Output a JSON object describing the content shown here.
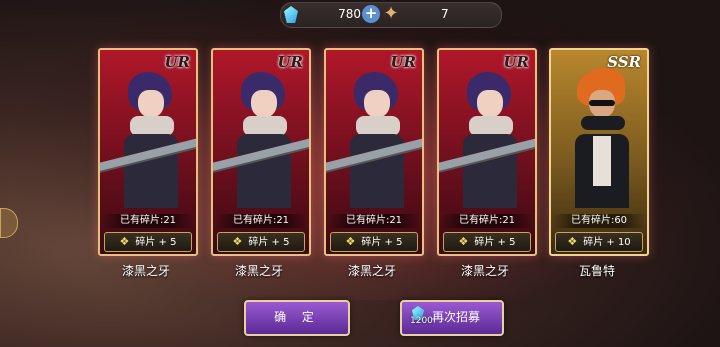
{
  "currency": {
    "gems": "780",
    "tickets": "7"
  },
  "cards": [
    {
      "rarity": "UR",
      "owned": "已有碎片:21",
      "gain": "碎片 + 5",
      "name": "漆黑之牙"
    },
    {
      "rarity": "UR",
      "owned": "已有碎片:21",
      "gain": "碎片 + 5",
      "name": "漆黑之牙"
    },
    {
      "rarity": "UR",
      "owned": "已有碎片:21",
      "gain": "碎片 + 5",
      "name": "漆黑之牙"
    },
    {
      "rarity": "UR",
      "owned": "已有碎片:21",
      "gain": "碎片 + 5",
      "name": "漆黑之牙"
    },
    {
      "rarity": "SSR",
      "owned": "已有碎片:60",
      "gain": "碎片 + 10",
      "name": "瓦鲁特"
    }
  ],
  "buttons": {
    "confirm": "确 定",
    "recruit_again": "再次招募",
    "recruit_cost": "1200"
  },
  "icons": {
    "currency": "gem-icon",
    "tickets": "ticket-icon",
    "shard": "shard-icon"
  }
}
